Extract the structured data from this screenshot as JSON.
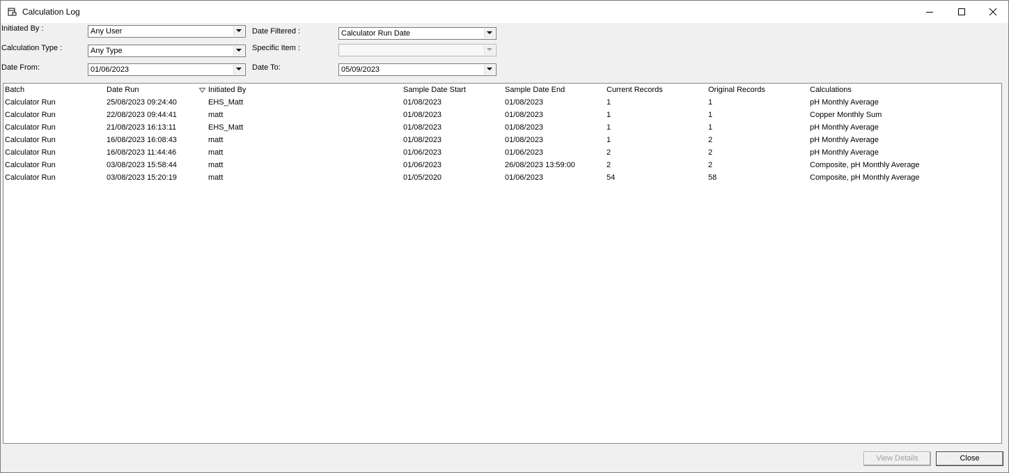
{
  "window": {
    "title": "Calculation Log"
  },
  "filters": {
    "initiated_by": {
      "label": "Initiated By :",
      "value": "Any User"
    },
    "calculation_type": {
      "label": "Calculation Type :",
      "value": "Any Type"
    },
    "date_from": {
      "label": "Date From:",
      "value": "01/06/2023"
    },
    "date_filtered": {
      "label": "Date Filtered :",
      "value": "Calculator Run Date"
    },
    "specific_item": {
      "label": "Specific Item :",
      "value": ""
    },
    "date_to": {
      "label": "Date To:",
      "value": "05/09/2023"
    }
  },
  "table": {
    "columns": [
      "Batch",
      "Date Run",
      "Initiated By",
      "Sample Date Start",
      "Sample Date End",
      "Current Records",
      "Original Records",
      "Calculations"
    ],
    "rows": [
      [
        "Calculator Run",
        "25/08/2023 09:24:40",
        "EHS_Matt",
        "01/08/2023",
        "01/08/2023",
        "1",
        "1",
        "pH Monthly Average"
      ],
      [
        "Calculator Run",
        "22/08/2023 09:44:41",
        "matt",
        "01/08/2023",
        "01/08/2023",
        "1",
        "1",
        "Copper Monthly Sum"
      ],
      [
        "Calculator Run",
        "21/08/2023 16:13:11",
        "EHS_Matt",
        "01/08/2023",
        "01/08/2023",
        "1",
        "1",
        "pH Monthly Average"
      ],
      [
        "Calculator Run",
        "16/08/2023 16:08:43",
        "matt",
        "01/08/2023",
        "01/08/2023",
        "1",
        "2",
        "pH Monthly Average"
      ],
      [
        "Calculator Run",
        "16/08/2023 11:44:46",
        "matt",
        "01/06/2023",
        "01/06/2023",
        "2",
        "2",
        "pH Monthly Average"
      ],
      [
        "Calculator Run",
        "03/08/2023 15:58:44",
        "matt",
        "01/06/2023",
        "26/08/2023 13:59:00",
        "2",
        "2",
        "Composite, pH Monthly Average"
      ],
      [
        "Calculator Run",
        "03/08/2023 15:20:19",
        "matt",
        "01/05/2020",
        "01/06/2023",
        "54",
        "58",
        "Composite, pH Monthly Average"
      ]
    ]
  },
  "buttons": {
    "view_details": "View Details",
    "close": "Close"
  },
  "icons": {
    "title": "log-window-icon",
    "minimize": "minimize-icon",
    "maximize": "maximize-icon",
    "close": "close-icon",
    "sort": "sort-descending-icon",
    "dropdown": "chevron-down-icon"
  }
}
